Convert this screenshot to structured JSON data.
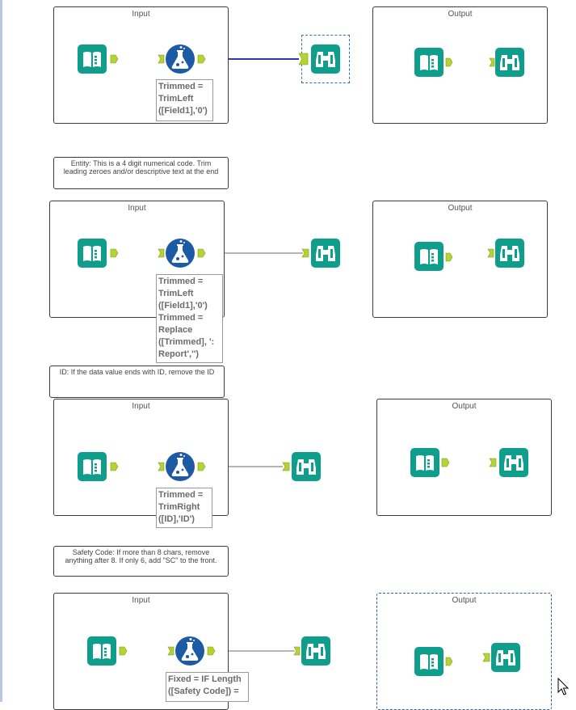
{
  "canvas": {
    "containers": [
      {
        "title": "Input"
      },
      {
        "title": "Output"
      },
      {
        "title": "Input"
      },
      {
        "title": "Output"
      },
      {
        "title": "Input"
      },
      {
        "title": "Output"
      },
      {
        "title": "Input"
      },
      {
        "title": "Output"
      }
    ],
    "comments": [
      {
        "text": "Entity: This is a 4 digit numerical code. Trim leading zeroes and/or descriptive text at the end"
      },
      {
        "text": "ID: If the data value ends with ID, remove the ID"
      },
      {
        "text": "Safety Code: If more than 8 chars, remove anything after 8. If only 6, add \"SC\" to the front."
      }
    ],
    "annotations": [
      {
        "lines": [
          "Trimmed =",
          "TrimLeft",
          "([Field1],'0')"
        ]
      },
      {
        "lines": [
          "Trimmed =",
          "TrimLeft",
          "([Field1],'0')",
          "Trimmed =",
          "Replace",
          "([Trimmed], ':",
          "Report','')"
        ]
      },
      {
        "lines": [
          "Trimmed =",
          "TrimRight",
          "([ID],'ID')"
        ]
      },
      {
        "lines": [
          "Fixed = IF Length",
          "([Safety Code]) ="
        ]
      }
    ]
  },
  "icons": {
    "input": "input-data-book-icon",
    "formula": "formula-flask-icon",
    "browse": "browse-binoculars-icon"
  },
  "colors": {
    "tool_teal": "#0f9e8c",
    "formula_blue": "#1d5aa6",
    "anchor_green": "#b5d334",
    "wire_gray": "#8a8a8a",
    "wire_selected": "#2d3f9c",
    "border": "#3a3a3a"
  }
}
